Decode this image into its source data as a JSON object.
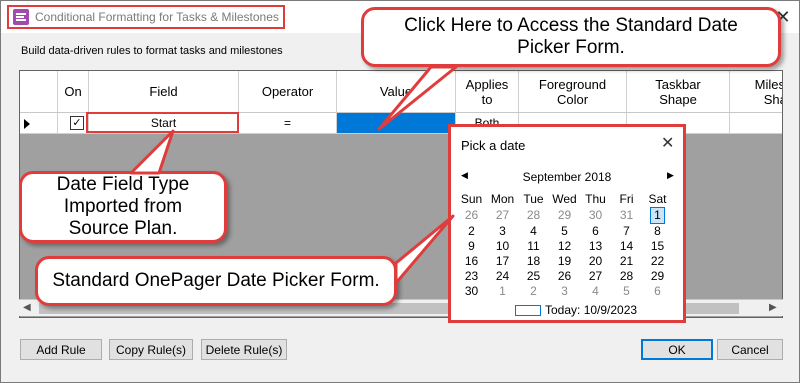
{
  "window": {
    "title": "Conditional Formatting for Tasks & Milestones",
    "subtitle": "Build data-driven rules to format tasks and milestones",
    "close_glyph": "✕"
  },
  "grid": {
    "columns": [
      "On",
      "Field",
      "Operator",
      "Value",
      "Applies to",
      "Foreground Color",
      "Taskbar Shape",
      "Milestone Shape"
    ],
    "row": {
      "on_checked": true,
      "check_glyph": "✓",
      "field": "Start",
      "operator": "=",
      "value": "",
      "applies_to": "Both"
    }
  },
  "buttons": {
    "add_rule": "Add Rule",
    "copy_rules": "Copy Rule(s)",
    "delete_rules": "Delete Rule(s)",
    "ok": "OK",
    "cancel": "Cancel"
  },
  "callouts": {
    "top": "Click Here to Access the Standard Date Picker Form.",
    "left": "Date Field Type Imported from Source Plan.",
    "bottom": "Standard OnePager Date Picker Form."
  },
  "picker": {
    "title": "Pick a date",
    "close_glyph": "✕",
    "prev_glyph": "◀",
    "next_glyph": "▶",
    "month_label": "September 2018",
    "weekdays": [
      "Sun",
      "Mon",
      "Tue",
      "Wed",
      "Thu",
      "Fri",
      "Sat"
    ],
    "weeks": [
      [
        "26",
        "27",
        "28",
        "29",
        "30",
        "31",
        "1"
      ],
      [
        "2",
        "3",
        "4",
        "5",
        "6",
        "7",
        "8"
      ],
      [
        "9",
        "10",
        "11",
        "12",
        "13",
        "14",
        "15"
      ],
      [
        "16",
        "17",
        "18",
        "19",
        "20",
        "21",
        "22"
      ],
      [
        "23",
        "24",
        "25",
        "26",
        "27",
        "28",
        "29"
      ],
      [
        "30",
        "1",
        "2",
        "3",
        "4",
        "5",
        "6"
      ]
    ],
    "selected_day": "1",
    "today_label": "Today: 10/9/2023"
  },
  "colors": {
    "highlight_red": "#e03c3c",
    "selection_blue": "#0078d7",
    "grid_background": "#a0a0a0"
  }
}
